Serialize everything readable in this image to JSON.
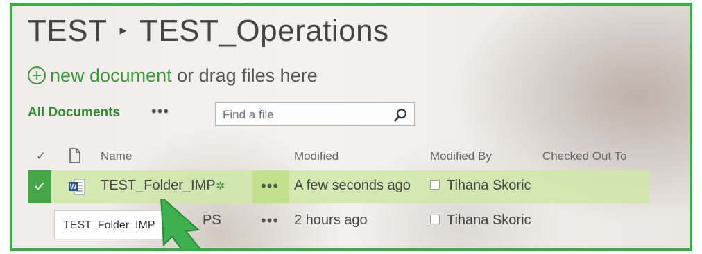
{
  "breadcrumb": {
    "parent": "TEST",
    "separator": "▸",
    "current": "TEST_Operations"
  },
  "upload": {
    "link_label": "new document",
    "suffix": " or drag files here"
  },
  "views": {
    "current": "All Documents",
    "more": "•••"
  },
  "search": {
    "placeholder": "Find a file"
  },
  "table": {
    "headers": {
      "check": "✓",
      "name": "Name",
      "modified": "Modified",
      "modified_by": "Modified By",
      "checked_out_to": "Checked Out To"
    },
    "rows": [
      {
        "name": "TEST_Folder_IMP",
        "new_badge": "✲",
        "menu": "•••",
        "modified": "A few seconds ago",
        "modified_by": "Tihana Skoric",
        "checked_out_to": ""
      },
      {
        "name_suffix": "PS",
        "menu": "•••",
        "modified": "2 hours ago",
        "modified_by": "Tihana Skoric",
        "checked_out_to": ""
      }
    ]
  },
  "tooltip": {
    "text": "TEST_Folder_IMP"
  },
  "colors": {
    "accent": "#3a9a3a",
    "frame": "#34b145",
    "row_selected": "#cfe8a8",
    "arrow": "#3fb04e"
  }
}
